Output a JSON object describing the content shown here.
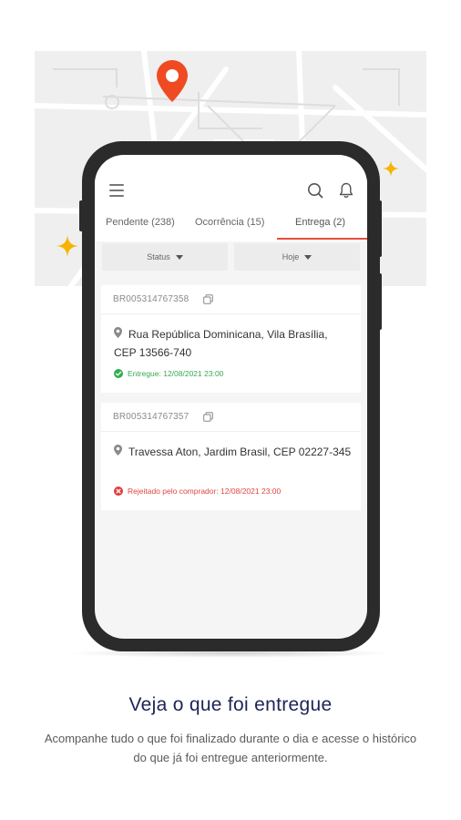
{
  "colors": {
    "accent": "#e74c3c",
    "pin": "#f04a23",
    "sparkle": "#f5b400",
    "success": "#2fae4f",
    "error": "#e33b3b",
    "title": "#1c2456"
  },
  "app": {
    "tabs": [
      {
        "label": "Pendente (238)"
      },
      {
        "label": "Ocorrência (15)"
      },
      {
        "label": "Entrega (2)",
        "active": true
      }
    ],
    "filters": {
      "status_label": "Status",
      "date_label": "Hoje"
    },
    "deliveries": [
      {
        "code": "BR005314767358",
        "address": "Rua República Dominicana, Vila Brasília, CEP 13566-740",
        "status": "Entregue: 12/08/2021 23:00",
        "status_type": "success"
      },
      {
        "code": "BR005314767357",
        "address": "Travessa Aton, Jardim Brasil, CEP 02227-345",
        "status": "Rejeitado pelo comprador: 12/08/2021 23:00",
        "status_type": "error"
      }
    ]
  },
  "caption": {
    "title": "Veja o que foi entregue",
    "text": "Acompanhe tudo o que foi finalizado durante o dia e acesse o histórico do que já foi entregue anteriormente."
  }
}
